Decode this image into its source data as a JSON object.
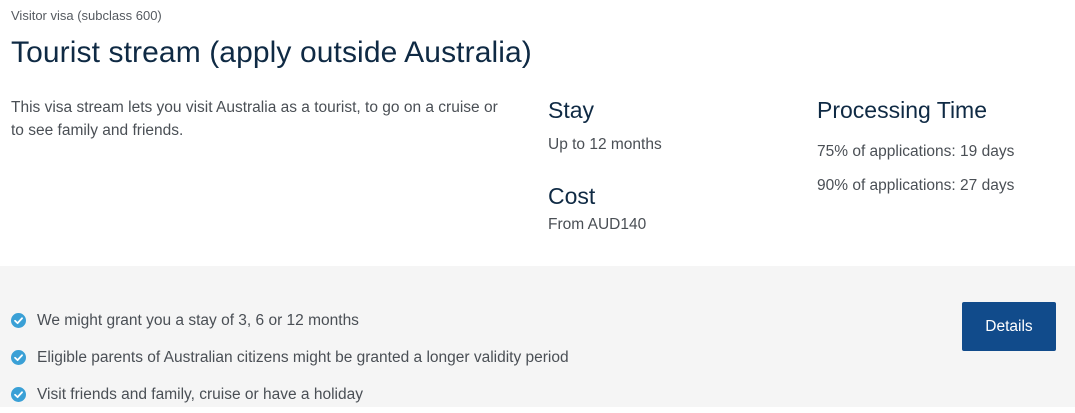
{
  "visa": {
    "subclass": "Visitor visa (subclass 600)",
    "title": "Tourist stream (apply outside Australia)",
    "description": "This visa stream lets you visit Australia as a tourist, to go on a cruise or to see family and friends."
  },
  "stay": {
    "heading": "Stay",
    "value": "Up to 12 months"
  },
  "cost": {
    "heading": "Cost",
    "value": "From AUD140"
  },
  "processing": {
    "heading": "Processing Time",
    "items": [
      "75% of applications: 19 days",
      "90% of applications: 27 days"
    ]
  },
  "highlights": [
    "We might grant you a stay of 3, 6 or 12 months",
    "Eligible parents of Australian citizens might be granted a longer validity period",
    "Visit friends and family, cruise or have a holiday"
  ],
  "actions": {
    "details_label": "Details"
  },
  "icons": {
    "bullet": "check-circle-icon"
  },
  "colors": {
    "heading": "#0f2a44",
    "button": "#114b8b",
    "check": "#3aa0d6",
    "panel_background": "#f5f5f5"
  }
}
